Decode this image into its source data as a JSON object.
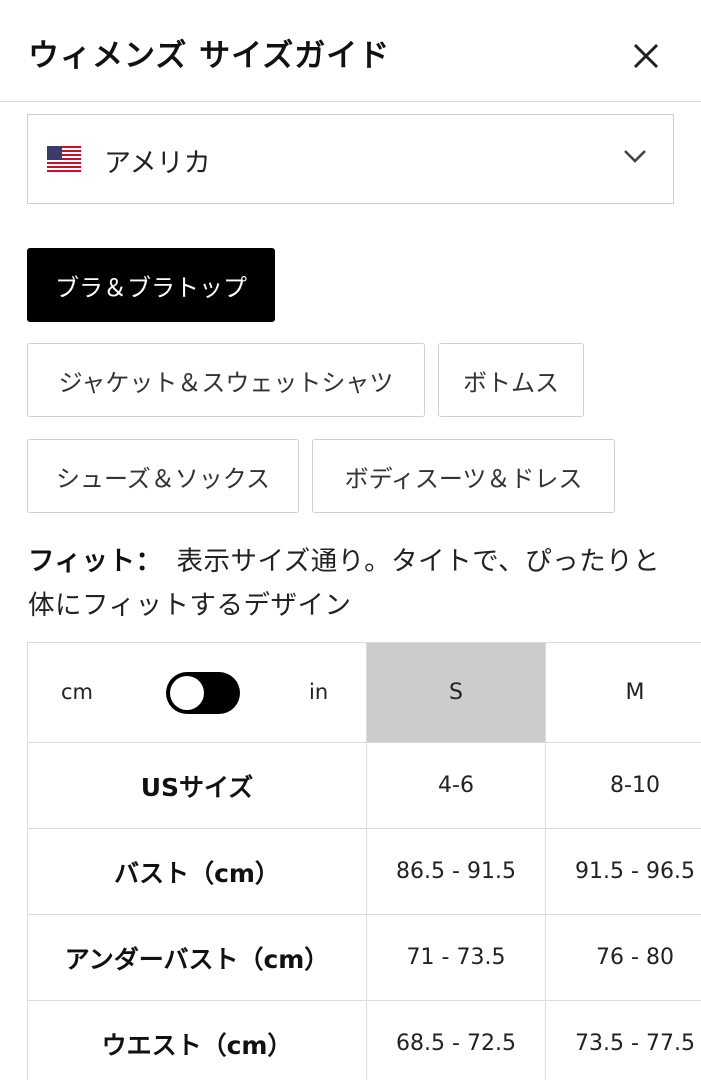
{
  "header": {
    "title": "ウィメンズ サイズガイド",
    "close_icon": "close-icon"
  },
  "country_select": {
    "flag_icon": "us-flag-icon",
    "value": "アメリカ",
    "chevron_icon": "chevron-down-icon"
  },
  "categories": [
    {
      "label": "ブラ＆ブラトップ",
      "active": true
    },
    {
      "label": "ジャケット＆スウェットシャツ",
      "active": false
    },
    {
      "label": "ボトムス",
      "active": false
    },
    {
      "label": "シューズ＆ソックス",
      "active": false
    },
    {
      "label": "ボディスーツ＆ドレス",
      "active": false
    }
  ],
  "fit": {
    "label": "フィット：",
    "text": "表示サイズ通り。タイトで、ぴったりと体にフィットするデザイン"
  },
  "size_table": {
    "unit_left": "cm",
    "unit_right": "in",
    "unit_toggle": "cm",
    "sizes": [
      "S",
      "M"
    ],
    "selected_size": "S",
    "rows": [
      {
        "label": "USサイズ",
        "values": [
          "4-6",
          "8-10"
        ]
      },
      {
        "label": "バスト（cm）",
        "values": [
          "86.5 - 91.5",
          "91.5 - 96.5"
        ]
      },
      {
        "label": "アンダーバスト（cm）",
        "values": [
          "71 - 73.5",
          "76 - 80"
        ]
      },
      {
        "label": "ウエスト（cm）",
        "values": [
          "68.5 - 72.5",
          "73.5 - 77.5"
        ]
      }
    ]
  },
  "colors": {
    "accent": "#000000",
    "selected_column": "#cccccc",
    "border": "#dcdcdc"
  }
}
